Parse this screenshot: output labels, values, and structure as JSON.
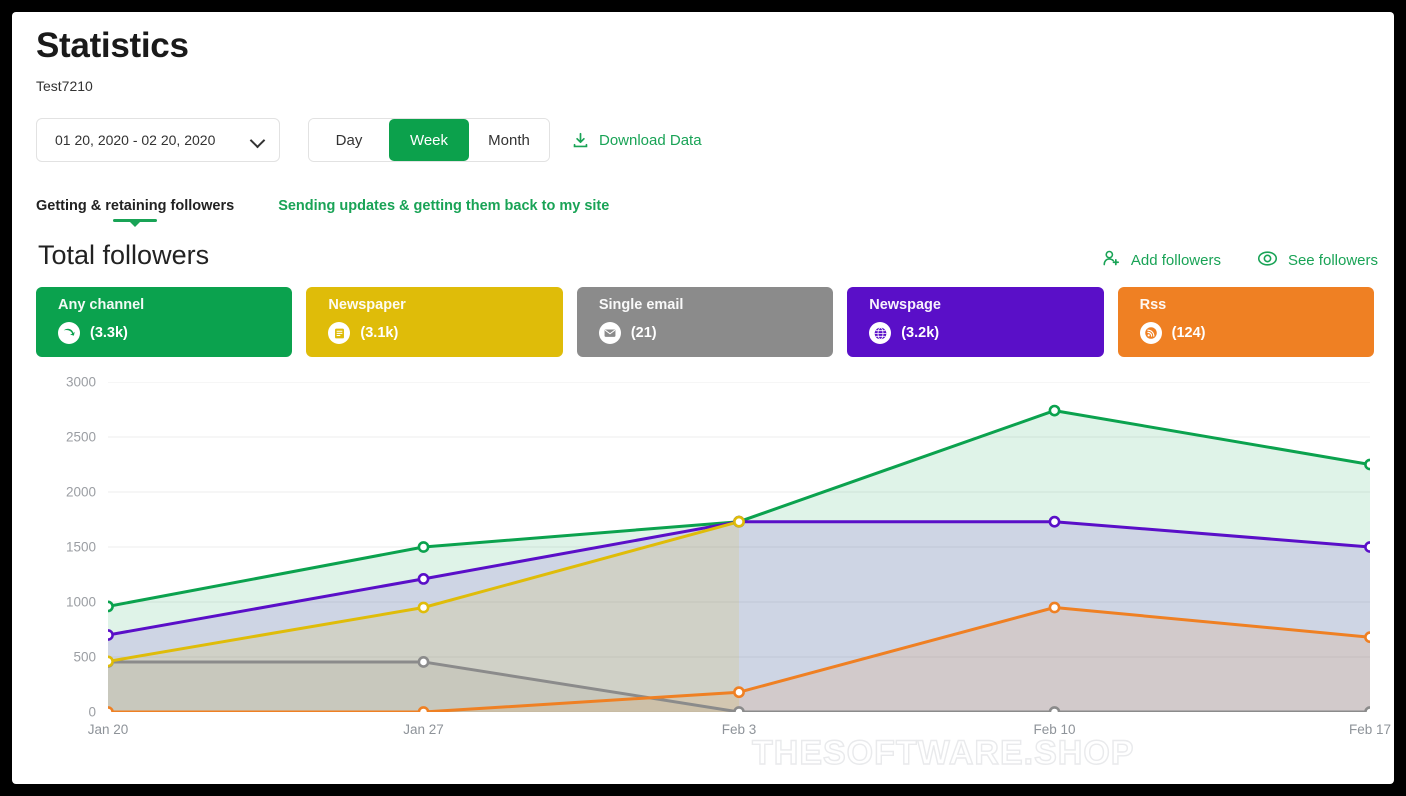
{
  "header": {
    "title": "Statistics",
    "account": "Test7210",
    "date_range": "01 20, 2020 - 02 20, 2020",
    "chevron_icon": "chevron-down-icon",
    "granularity": [
      {
        "label": "Day",
        "active": false
      },
      {
        "label": "Week",
        "active": true
      },
      {
        "label": "Month",
        "active": false
      }
    ],
    "download": {
      "label": "Download Data",
      "icon": "download-icon"
    }
  },
  "tabs": [
    {
      "label": "Getting & retaining followers",
      "active": true
    },
    {
      "label": "Sending updates & getting them back to my site",
      "active": false
    }
  ],
  "section": {
    "title": "Total followers",
    "actions": [
      {
        "label": "Add followers",
        "icon": "add-user-icon"
      },
      {
        "label": "See followers",
        "icon": "eye-icon"
      }
    ]
  },
  "cards": [
    {
      "title": "Any channel",
      "count": "(3.3k)",
      "color": "#0ba24e",
      "icon": "channel-icon"
    },
    {
      "title": "Newspaper",
      "count": "(3.1k)",
      "color": "#dfbc09",
      "icon": "newspaper-icon"
    },
    {
      "title": "Single email",
      "count": "(21)",
      "color": "#8b8b8b",
      "icon": "envelope-icon"
    },
    {
      "title": "Newspage",
      "count": "(3.2k)",
      "color": "#5a0fc8",
      "icon": "globe-icon"
    },
    {
      "title": "Rss",
      "count": "(124)",
      "color": "#ef8023",
      "icon": "rss-icon"
    }
  ],
  "watermark": "THESOFTWARE.SHOP",
  "chart_data": {
    "type": "area",
    "title": "Total followers",
    "xlabel": "",
    "ylabel": "",
    "grid": true,
    "legend": "cards",
    "categories": [
      "Jan 20",
      "Jan 27",
      "Feb 3",
      "Feb 10",
      "Feb 17"
    ],
    "ylim": [
      0,
      3000
    ],
    "yticks": [
      0,
      500,
      1000,
      1500,
      2000,
      2500,
      3000
    ],
    "series": [
      {
        "name": "Any channel",
        "color": "#0ba24e",
        "values": [
          960,
          1500,
          1730,
          2740,
          2250
        ]
      },
      {
        "name": "Newspage",
        "color": "#5a0fc8",
        "values": [
          700,
          1210,
          1730,
          1730,
          1500
        ]
      },
      {
        "name": "Newspaper",
        "color": "#dfbc09",
        "values": [
          460,
          950,
          1730,
          null,
          null
        ]
      },
      {
        "name": "Single email",
        "color": "#8b8b8b",
        "values": [
          455,
          455,
          0,
          0,
          0
        ]
      },
      {
        "name": "Rss",
        "color": "#ef8023",
        "values": [
          0,
          0,
          180,
          950,
          680
        ]
      }
    ]
  }
}
